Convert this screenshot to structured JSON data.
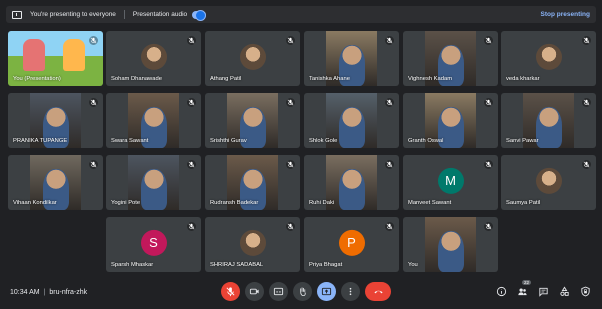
{
  "presenting_bar": {
    "status": "You're presenting to everyone",
    "audio_label": "Presentation audio",
    "audio_on": true,
    "stop_label": "Stop presenting"
  },
  "tiles": [
    {
      "name": "You (Presentation)",
      "kind": "presentation"
    },
    {
      "name": "Soham Dhanawade",
      "kind": "photo"
    },
    {
      "name": "Athang Patil",
      "kind": "photo"
    },
    {
      "name": "Tanishka Ahane",
      "kind": "video"
    },
    {
      "name": "Vighnesh Kadam",
      "kind": "video"
    },
    {
      "name": "veda kharkar",
      "kind": "photo"
    },
    {
      "name": "PRANIKA TUPANGE",
      "kind": "video"
    },
    {
      "name": "Swara Sawant",
      "kind": "video"
    },
    {
      "name": "Srishthi Gurav",
      "kind": "video"
    },
    {
      "name": "Shlok Gole",
      "kind": "video"
    },
    {
      "name": "Granth Oswal",
      "kind": "video"
    },
    {
      "name": "Sanvi Pawar",
      "kind": "video"
    },
    {
      "name": "Vihaan Kondilkar",
      "kind": "video"
    },
    {
      "name": "Yogini Pote",
      "kind": "video"
    },
    {
      "name": "Rudransh Badekar",
      "kind": "video"
    },
    {
      "name": "Ruhi Daki",
      "kind": "video"
    },
    {
      "name": "Manveet Sawant",
      "kind": "letter",
      "letter": "M",
      "color": "#00796b"
    },
    {
      "name": "Saumya Patil",
      "kind": "photo"
    },
    {
      "name": "Sparsh Mhaskar",
      "kind": "letter",
      "letter": "S",
      "color": "#c2185b"
    },
    {
      "name": "SHRIRAJ SADABAL",
      "kind": "photo"
    },
    {
      "name": "Priya Bhagat",
      "kind": "letter",
      "letter": "P",
      "color": "#ef6c00"
    },
    {
      "name": "You",
      "kind": "video"
    }
  ],
  "bottom": {
    "time": "10:34 AM",
    "meeting_code": "bru-nfra-zhk",
    "participant_count": "22"
  },
  "colors": {
    "accent": "#8ab4f8",
    "danger": "#ea4335",
    "tile_bg": "#3c4043",
    "page_bg": "#202124"
  }
}
